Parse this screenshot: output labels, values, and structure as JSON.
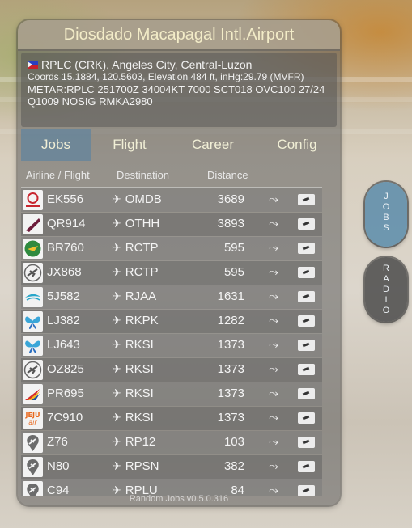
{
  "airport_title": "Diosdado Macapagal Intl.Airport",
  "info": {
    "location": "RPLC (CRK), Angeles City, Central-Luzon",
    "coords": "Coords 15.1884, 120.5603, Elevation 484 ft, inHg:29.79 (MVFR)",
    "metar_line1": "METAR:RPLC 251700Z 34004KT 7000 SCT018 OVC100 27/24",
    "metar_line2": "Q1009 NOSIG RMKA2980",
    "flag": "philippines-flag"
  },
  "tabs": [
    "Jobs",
    "Flight",
    "Career",
    "Config"
  ],
  "active_tab": "Jobs",
  "columns": {
    "airline": "Airline / Flight",
    "destination": "Destination",
    "distance": "Distance"
  },
  "jobs": [
    {
      "flight": "EK556",
      "dest": "OMDB",
      "distance": "3689",
      "logo": "emirates"
    },
    {
      "flight": "QR914",
      "dest": "OTHH",
      "distance": "3893",
      "logo": "qatar"
    },
    {
      "flight": "BR760",
      "dest": "RCTP",
      "distance": "595",
      "logo": "eva"
    },
    {
      "flight": "JX868",
      "dest": "RCTP",
      "distance": "595",
      "logo": "generic-plane"
    },
    {
      "flight": "5J582",
      "dest": "RJAA",
      "distance": "1631",
      "logo": "cebu"
    },
    {
      "flight": "LJ382",
      "dest": "RKPK",
      "distance": "1282",
      "logo": "jinair"
    },
    {
      "flight": "LJ643",
      "dest": "RKSI",
      "distance": "1373",
      "logo": "jinair"
    },
    {
      "flight": "OZ825",
      "dest": "RKSI",
      "distance": "1373",
      "logo": "generic-plane"
    },
    {
      "flight": "PR695",
      "dest": "RKSI",
      "distance": "1373",
      "logo": "pal"
    },
    {
      "flight": "7C910",
      "dest": "RKSI",
      "distance": "1373",
      "logo": "jeju"
    },
    {
      "flight": "Z76",
      "dest": "RP12",
      "distance": "103",
      "logo": "marker"
    },
    {
      "flight": "N80",
      "dest": "RPSN",
      "distance": "382",
      "logo": "marker"
    },
    {
      "flight": "C94",
      "dest": "RPLU",
      "distance": "84",
      "logo": "marker"
    }
  ],
  "footer": "Random Jobs v0.5.0.316",
  "side_buttons": {
    "jobs": [
      "J",
      "O",
      "B",
      "S"
    ],
    "radio": [
      "R",
      "A",
      "D",
      "I",
      "O"
    ]
  }
}
